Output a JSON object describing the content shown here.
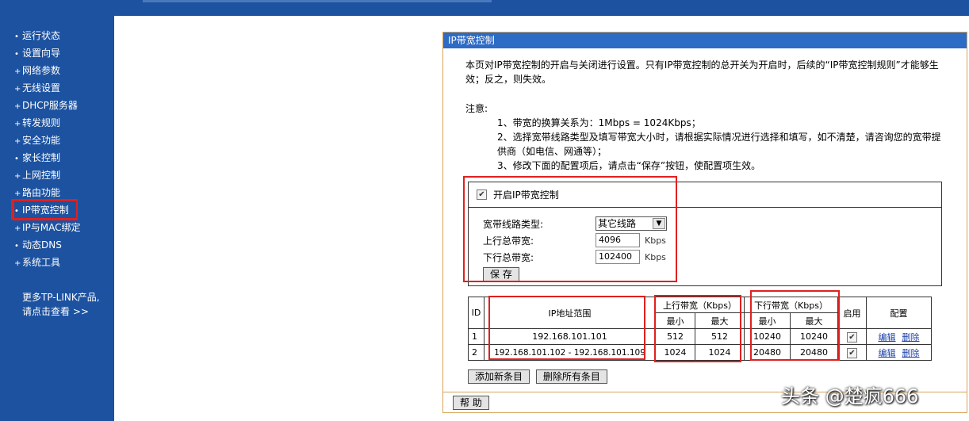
{
  "sidebar": {
    "items": [
      {
        "label": "运行状态",
        "bullet": "•"
      },
      {
        "label": "设置向导",
        "bullet": "•"
      },
      {
        "label": "网络参数",
        "bullet": "+"
      },
      {
        "label": "无线设置",
        "bullet": "+"
      },
      {
        "label": "DHCP服务器",
        "bullet": "+"
      },
      {
        "label": "转发规则",
        "bullet": "+"
      },
      {
        "label": "安全功能",
        "bullet": "+"
      },
      {
        "label": "家长控制",
        "bullet": "•"
      },
      {
        "label": "上网控制",
        "bullet": "+"
      },
      {
        "label": "路由功能",
        "bullet": "+"
      },
      {
        "label": "IP带宽控制",
        "bullet": "•"
      },
      {
        "label": "IP与MAC绑定",
        "bullet": "+"
      },
      {
        "label": "动态DNS",
        "bullet": "•"
      },
      {
        "label": "系统工具",
        "bullet": "+"
      }
    ],
    "more_line1": "更多TP-LINK产品,",
    "more_line2": "请点击查看 >>"
  },
  "panel": {
    "title": "IP带宽控制",
    "intro": "本页对IP带宽控制的开启与关闭进行设置。只有IP带宽控制的总开关为开启时，后续的“IP带宽控制规则”才能够生效；反之，则失效。",
    "note_title": "注意:",
    "note1": "1、带宽的换算关系为：1Mbps = 1024Kbps；",
    "note2": "2、选择宽带线路类型及填写带宽大小时，请根据实际情况进行选择和填写，如不清楚，请咨询您的宽带提供商（如电信、网通等）；",
    "note3": "3、修改下面的配置项后，请点击“保存”按钮，使配置项生效。"
  },
  "config": {
    "enable_label": "开启IP带宽控制",
    "line_type_label": "宽带线路类型:",
    "line_type_value": "其它线路",
    "up_label": "上行总带宽:",
    "up_value": "4096",
    "down_label": "下行总带宽:",
    "down_value": "102400",
    "unit": "Kbps",
    "save_label": "保 存"
  },
  "table": {
    "h_id": "ID",
    "h_range": "IP地址范围",
    "h_up": "上行带宽（Kbps）",
    "h_down": "下行带宽（Kbps）",
    "h_enable": "启用",
    "h_config": "配置",
    "h_min": "最小",
    "h_max": "最大",
    "edit": "编辑",
    "delete": "删除",
    "rows": [
      {
        "id": "1",
        "range": "192.168.101.101",
        "up_min": "512",
        "up_max": "512",
        "down_min": "10240",
        "down_max": "10240"
      },
      {
        "id": "2",
        "range": "192.168.101.102 - 192.168.101.109",
        "up_min": "1024",
        "up_max": "1024",
        "down_min": "20480",
        "down_max": "20480"
      }
    ]
  },
  "buttons": {
    "add": "添加新条目",
    "delete_all": "删除所有条目",
    "help": "帮 助"
  },
  "watermark": "头条 @楚疯666",
  "colors": {
    "sidebar_bg": "#1c52a0",
    "panel_header": "#2d6bc4",
    "highlight": "#e0201f"
  }
}
